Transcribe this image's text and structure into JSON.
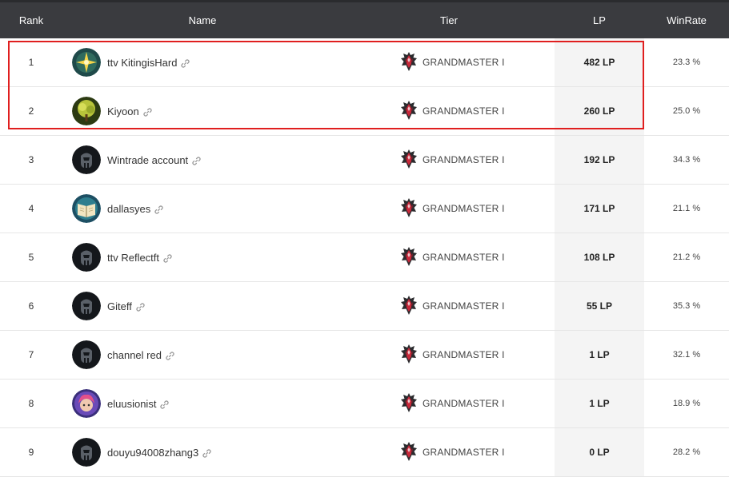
{
  "header": {
    "rank": "Rank",
    "name": "Name",
    "tier": "Tier",
    "lp": "LP",
    "winrate": "WinRate"
  },
  "colors": {
    "header_bg": "#3a3b3f",
    "lp_column_bg": "#f4f4f4",
    "highlight_border": "#e01f1f"
  },
  "rows": [
    {
      "rank": "1",
      "name": "ttv KitingisHard",
      "avatar": "star-icon-avatar",
      "tier": "GRANDMASTER I",
      "lp": "482 LP",
      "winrate": "23.3 %"
    },
    {
      "rank": "2",
      "name": "Kiyoon",
      "avatar": "tree-icon-avatar",
      "tier": "GRANDMASTER I",
      "lp": "260 LP",
      "winrate": "25.0 %"
    },
    {
      "rank": "3",
      "name": "Wintrade account",
      "avatar": "helmet-icon-avatar",
      "tier": "GRANDMASTER I",
      "lp": "192 LP",
      "winrate": "34.3 %"
    },
    {
      "rank": "4",
      "name": "dallasyes",
      "avatar": "book-icon-avatar",
      "tier": "GRANDMASTER I",
      "lp": "171 LP",
      "winrate": "21.1 %"
    },
    {
      "rank": "5",
      "name": "ttv Reflectft",
      "avatar": "helmet-icon-avatar",
      "tier": "GRANDMASTER I",
      "lp": "108 LP",
      "winrate": "21.2 %"
    },
    {
      "rank": "6",
      "name": "Giteff",
      "avatar": "helmet-icon-avatar",
      "tier": "GRANDMASTER I",
      "lp": "55 LP",
      "winrate": "35.3 %"
    },
    {
      "rank": "7",
      "name": "channel red",
      "avatar": "helmet-icon-avatar",
      "tier": "GRANDMASTER I",
      "lp": "1 LP",
      "winrate": "32.1 %"
    },
    {
      "rank": "8",
      "name": "eluusionist",
      "avatar": "character-icon-avatar",
      "tier": "GRANDMASTER I",
      "lp": "1 LP",
      "winrate": "18.9 %"
    },
    {
      "rank": "9",
      "name": "douyu94008zhang3",
      "avatar": "helmet-icon-avatar",
      "tier": "GRANDMASTER I",
      "lp": "0 LP",
      "winrate": "28.2 %"
    }
  ]
}
